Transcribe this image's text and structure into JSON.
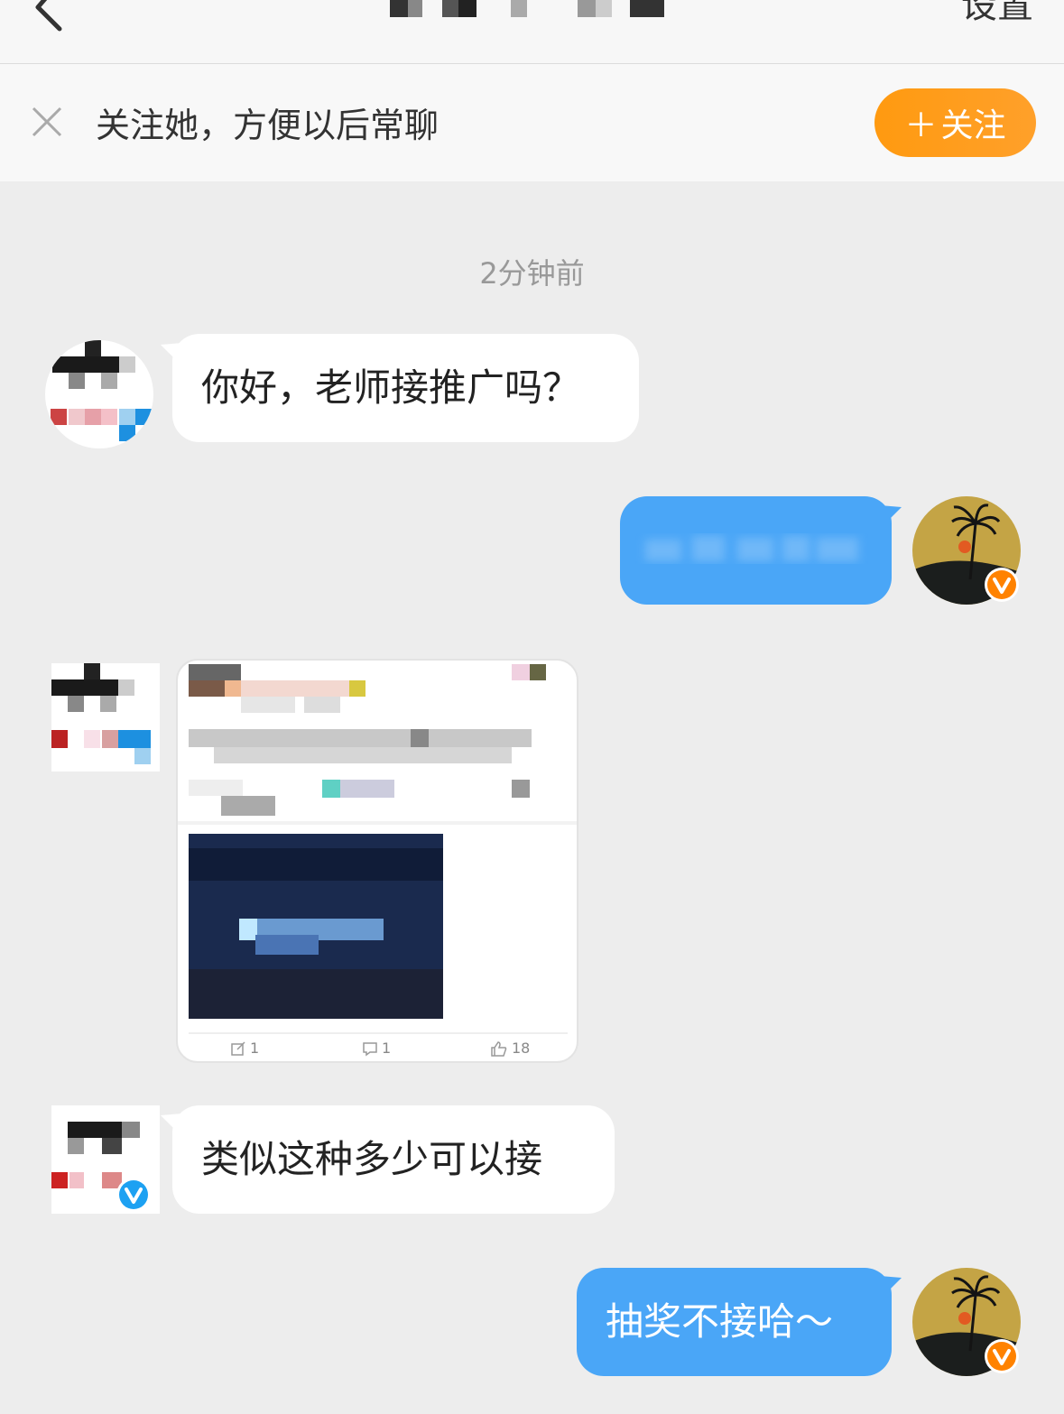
{
  "header": {
    "settings_label": "设置"
  },
  "follow_bar": {
    "text": "关注她，方便以后常聊",
    "button_plus": "＋",
    "button_label": "关注"
  },
  "conversation": {
    "timestamp": "2分钟前",
    "messages": [
      {
        "side": "left",
        "text": "你好，老师接推广吗？"
      },
      {
        "side": "right",
        "text": ""
      },
      {
        "side": "left",
        "type": "card",
        "stats": {
          "reposts": "1",
          "comments": "1",
          "likes": "18"
        }
      },
      {
        "side": "left",
        "text": "类似这种多少可以接"
      },
      {
        "side": "right",
        "text": "抽奖不接哈～"
      }
    ]
  },
  "colors": {
    "accent_orange": "#ff9a10",
    "bubble_blue": "#4aa6f7",
    "background": "#ededed",
    "verified_blue": "#1da1f2",
    "verified_orange": "#ff8200"
  }
}
